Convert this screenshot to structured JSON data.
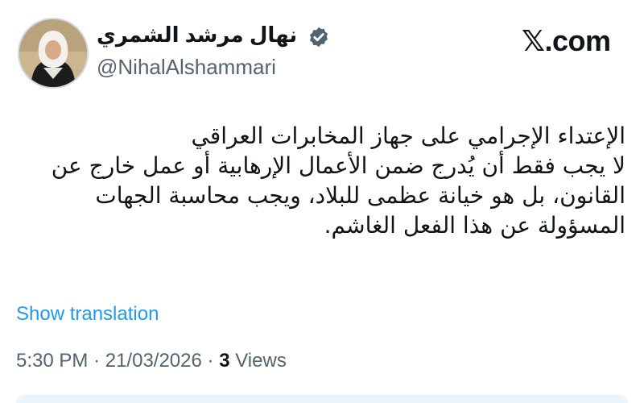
{
  "brand": {
    "x": "𝕏",
    "suffix": ".com"
  },
  "author": {
    "display_name": "نهال مرشد الشمري",
    "handle": "@NihalAlshammari",
    "verified_color": "#536471"
  },
  "tweet": {
    "lines": [
      "الإعتداء الإجرامي على جهاز المخابرات العراقي",
      "لا يجب فقط أن يُدرج ضمن الأعمال الإرهابية أو عمل خارج عن",
      "القانون، بل هو خيانة عظمى للبلاد، ويجب محاسبة الجهات",
      "المسؤولة عن هذا الفعل الغاشم."
    ],
    "show_translation": "Show translation",
    "time": "5:30 PM",
    "separator": "·",
    "date": "21/03/2026",
    "views_count": "3",
    "views_label": "Views"
  },
  "colors": {
    "link": "#1d9bf0",
    "secondary": "#536471",
    "text": "#0f1419"
  }
}
